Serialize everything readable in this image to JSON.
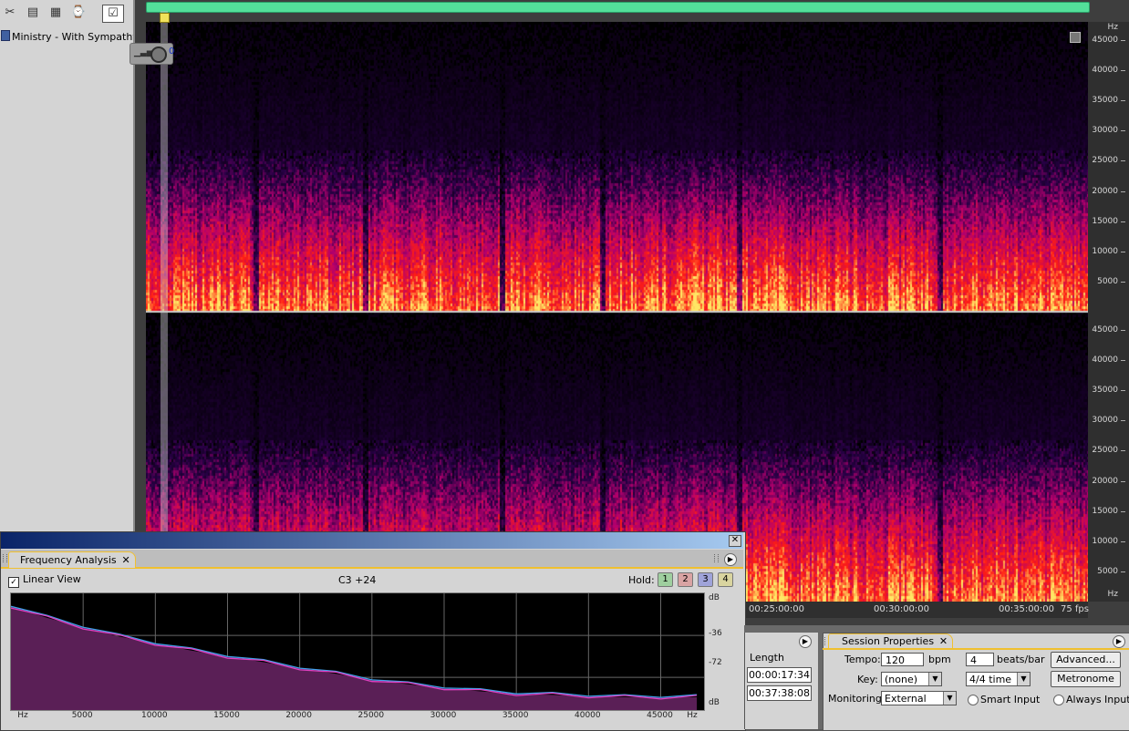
{
  "files": {
    "items": [
      {
        "name": "Ministry - With Sympathy.wav"
      }
    ]
  },
  "editor": {
    "gain_value": "0",
    "hz_unit": "Hz",
    "hz_ticks": [
      "45000",
      "40000",
      "35000",
      "30000",
      "25000",
      "20000",
      "15000",
      "10000",
      "5000"
    ],
    "timeline_labels": [
      "00:25:00:00",
      "00:30:00:00",
      "00:35:00:00"
    ],
    "fps": "75 fps"
  },
  "frequency_analysis": {
    "tab_label": "Frequency Analysis",
    "linear_view_label": "Linear View",
    "linear_view_checked": true,
    "note_readout": "C3 +24",
    "hold_label": "Hold:",
    "hold_buttons": [
      {
        "label": "1",
        "color": "#9fcf9f"
      },
      {
        "label": "2",
        "color": "#d9a3a3"
      },
      {
        "label": "3",
        "color": "#9fa3d9"
      },
      {
        "label": "4",
        "color": "#d9d49f"
      }
    ],
    "db_labels": [
      "dB",
      "-36",
      "-72",
      "dB"
    ],
    "x_labels": [
      "Hz",
      "5000",
      "10000",
      "15000",
      "20000",
      "25000",
      "30000",
      "35000",
      "40000",
      "45000",
      "Hz"
    ],
    "chart_data": {
      "type": "area",
      "x_unit": "Hz",
      "y_unit": "dB",
      "x": [
        0,
        2500,
        5000,
        7500,
        10000,
        12500,
        15000,
        17500,
        20000,
        22500,
        25000,
        27500,
        30000,
        32500,
        35000,
        37500,
        40000,
        42500,
        45000,
        47500
      ],
      "series": [
        {
          "color": "#3fa0e8",
          "values": [
            -10,
            -20,
            -28,
            -36,
            -42,
            -48,
            -53,
            -58,
            -63,
            -68,
            -73,
            -77,
            -80,
            -83,
            -85,
            -86,
            -87,
            -88,
            -88,
            -88
          ]
        },
        {
          "color": "#e040c0",
          "values": [
            -11,
            -21,
            -29,
            -37,
            -43,
            -49,
            -54,
            -59,
            -64,
            -69,
            -74,
            -78,
            -81,
            -84,
            -86,
            -87,
            -88,
            -89,
            -89,
            -89
          ]
        }
      ],
      "ylim": [
        -100,
        0
      ],
      "xlim": [
        0,
        48000
      ],
      "grid": true
    }
  },
  "time_panel": {
    "length_header": "Length",
    "values": [
      "00:00:17:34",
      "00:37:38:08"
    ]
  },
  "session_properties": {
    "tab_label": "Session Properties",
    "tempo_label": "Tempo:",
    "tempo_value": "120",
    "bpm_label": "bpm",
    "beats_value": "4",
    "beats_label": "beats/bar",
    "advanced_label": "Advanced...",
    "key_label": "Key:",
    "key_value": "(none)",
    "time_sig_value": "4/4 time",
    "metronome_label": "Metronome",
    "monitoring_label": "Monitoring:",
    "monitoring_value": "External",
    "smart_input_label": "Smart Input",
    "always_input_label": "Always Input"
  }
}
